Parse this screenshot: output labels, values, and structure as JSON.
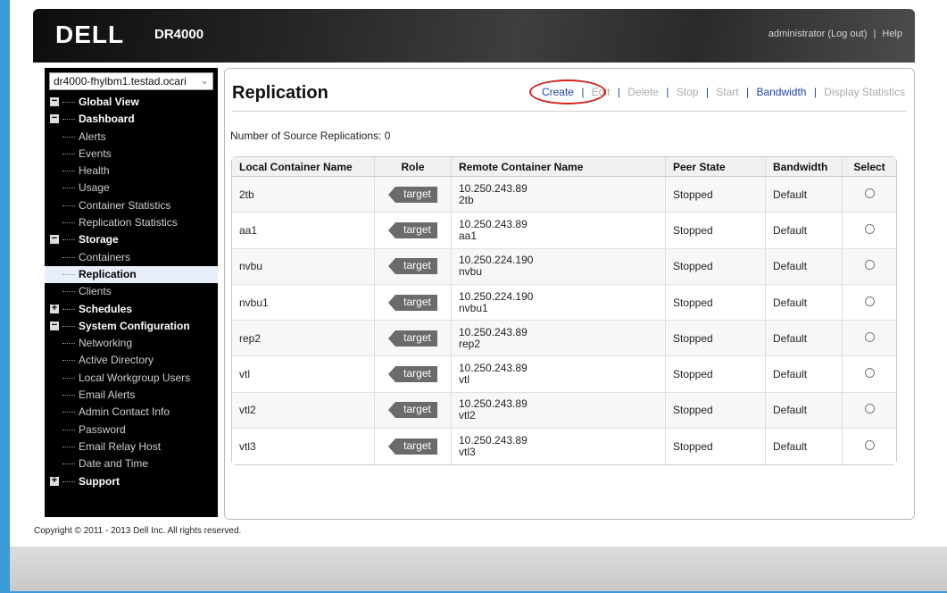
{
  "header": {
    "brand": "DELL",
    "product": "DR4000",
    "user": "administrator",
    "logout_label": "(Log out)",
    "separator": "|",
    "help_label": "Help"
  },
  "sidebar": {
    "system": "dr4000-fhylbm1.testad.ocari",
    "items": [
      {
        "label": "Global View",
        "type": "section",
        "toggle": "−"
      },
      {
        "label": "Dashboard",
        "type": "section",
        "toggle": "−"
      },
      {
        "label": "Alerts",
        "type": "child"
      },
      {
        "label": "Events",
        "type": "child"
      },
      {
        "label": "Health",
        "type": "child"
      },
      {
        "label": "Usage",
        "type": "child"
      },
      {
        "label": "Container Statistics",
        "type": "child"
      },
      {
        "label": "Replication Statistics",
        "type": "child"
      },
      {
        "label": "Storage",
        "type": "section",
        "toggle": "−"
      },
      {
        "label": "Containers",
        "type": "child"
      },
      {
        "label": "Replication",
        "type": "child",
        "active": true
      },
      {
        "label": "Clients",
        "type": "child"
      },
      {
        "label": "Schedules",
        "type": "section",
        "toggle": "+"
      },
      {
        "label": "System Configuration",
        "type": "section",
        "toggle": "−"
      },
      {
        "label": "Networking",
        "type": "child"
      },
      {
        "label": "Active Directory",
        "type": "child"
      },
      {
        "label": "Local Workgroup Users",
        "type": "child"
      },
      {
        "label": "Email Alerts",
        "type": "child"
      },
      {
        "label": "Admin Contact Info",
        "type": "child"
      },
      {
        "label": "Password",
        "type": "child"
      },
      {
        "label": "Email Relay Host",
        "type": "child"
      },
      {
        "label": "Date and Time",
        "type": "child"
      },
      {
        "label": "Support",
        "type": "section",
        "toggle": "+"
      }
    ]
  },
  "main": {
    "title": "Replication",
    "actions": {
      "create": "Create",
      "edit": "Edit",
      "delete": "Delete",
      "stop": "Stop",
      "start": "Start",
      "bandwidth": "Bandwidth",
      "display_statistics": "Display Statistics",
      "separator": "|"
    },
    "source_count_label": "Number of Source Replications: 0",
    "table": {
      "headers": [
        "Local Container Name",
        "Role",
        "Remote Container Name",
        "Peer State",
        "Bandwidth",
        "Select"
      ],
      "rows": [
        {
          "local": "2tb",
          "role": "target",
          "remote_ip": "10.250.243.89",
          "remote_name": "2tb",
          "peer_state": "Stopped",
          "bandwidth": "Default"
        },
        {
          "local": "aa1",
          "role": "target",
          "remote_ip": "10.250.243.89",
          "remote_name": "aa1",
          "peer_state": "Stopped",
          "bandwidth": "Default"
        },
        {
          "local": "nvbu",
          "role": "target",
          "remote_ip": "10.250.224.190",
          "remote_name": "nvbu",
          "peer_state": "Stopped",
          "bandwidth": "Default"
        },
        {
          "local": "nvbu1",
          "role": "target",
          "remote_ip": "10.250.224.190",
          "remote_name": "nvbu1",
          "peer_state": "Stopped",
          "bandwidth": "Default"
        },
        {
          "local": "rep2",
          "role": "target",
          "remote_ip": "10.250.243.89",
          "remote_name": "rep2",
          "peer_state": "Stopped",
          "bandwidth": "Default"
        },
        {
          "local": "vtl",
          "role": "target",
          "remote_ip": "10.250.243.89",
          "remote_name": "vtl",
          "peer_state": "Stopped",
          "bandwidth": "Default"
        },
        {
          "local": "vtl2",
          "role": "target",
          "remote_ip": "10.250.243.89",
          "remote_name": "vtl2",
          "peer_state": "Stopped",
          "bandwidth": "Default"
        },
        {
          "local": "vtl3",
          "role": "target",
          "remote_ip": "10.250.243.89",
          "remote_name": "vtl3",
          "peer_state": "Stopped",
          "bandwidth": "Default"
        }
      ]
    }
  },
  "footer": {
    "copyright": "Copyright © 2011 - 2013 Dell Inc. All rights reserved."
  },
  "colors": {
    "accent_blue": "#3a9ad9",
    "link_blue": "#1f3fae",
    "highlight_red": "#d42020"
  }
}
